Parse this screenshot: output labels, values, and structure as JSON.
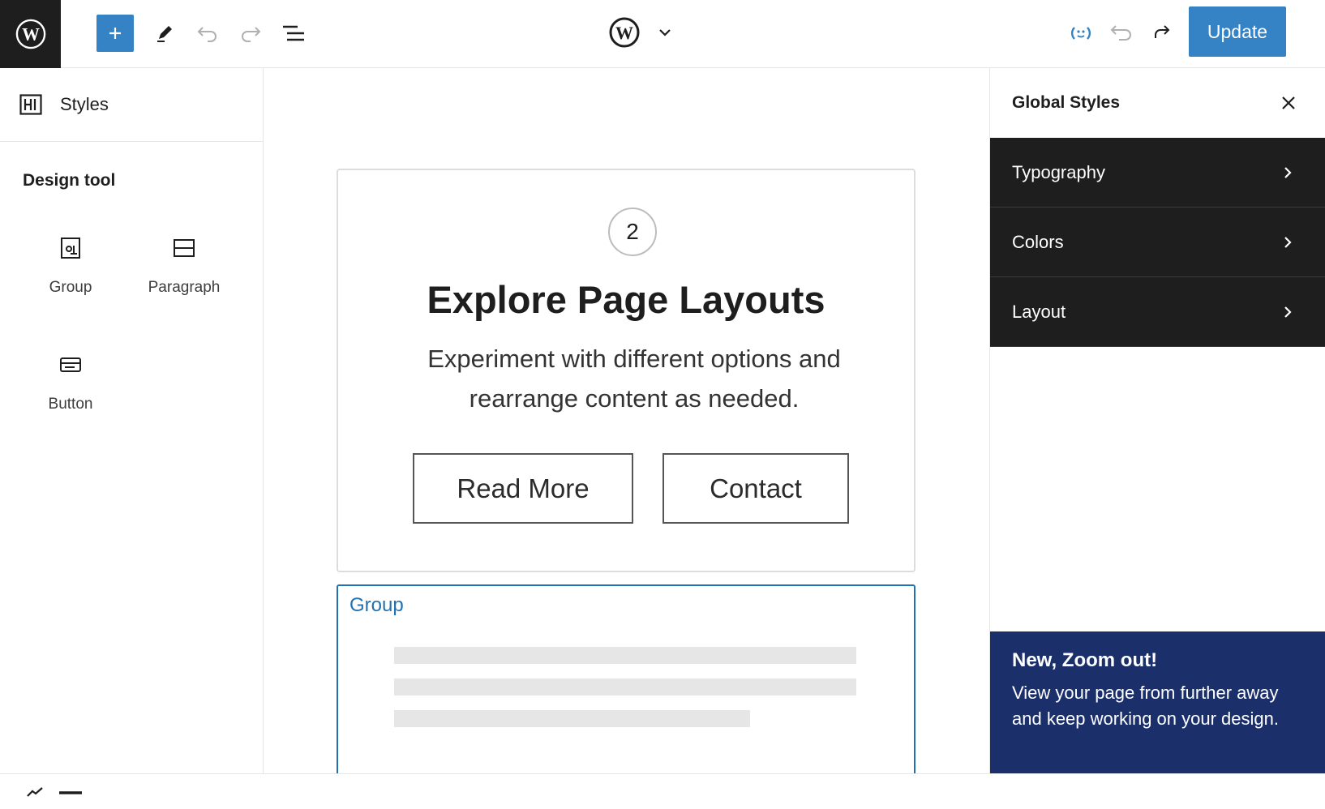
{
  "toolbar": {
    "update_label": "Update",
    "icons": [
      "wordpress-icon",
      "plus-icon",
      "pencil-icon",
      "undo-icon",
      "redo-icon",
      "list-view-icon",
      "wordpress-icon",
      "chevron-down-icon",
      "style-book-icon",
      "undo-icon",
      "redo-icon"
    ]
  },
  "left_panel": {
    "title": "Styles",
    "section_title": "Design tool",
    "blocks": [
      {
        "label": "Group",
        "icon": "group-block-icon"
      },
      {
        "label": "Paragraph",
        "icon": "paragraph-block-icon"
      },
      {
        "label": "Button",
        "icon": "button-block-icon"
      }
    ]
  },
  "canvas": {
    "step_number": "2",
    "heading": "Explore Page Layouts",
    "description_line1": "Experiment with different options and",
    "description_line2": "rearrange content as needed.",
    "read_more_label": "Read More",
    "contact_label": "Contact",
    "group_label": "Group"
  },
  "right_panel": {
    "title": "Global Styles",
    "items": [
      {
        "label": "Typography"
      },
      {
        "label": "Colors"
      },
      {
        "label": "Layout"
      }
    ],
    "tip": {
      "title": "New, Zoom out!",
      "text": "View your page from further away and keep working on your design."
    }
  },
  "colors": {
    "accent": "#3582c4",
    "selection": "#2271b1",
    "dark": "#1e1e1e",
    "tip_bg": "#1b2f6b"
  }
}
